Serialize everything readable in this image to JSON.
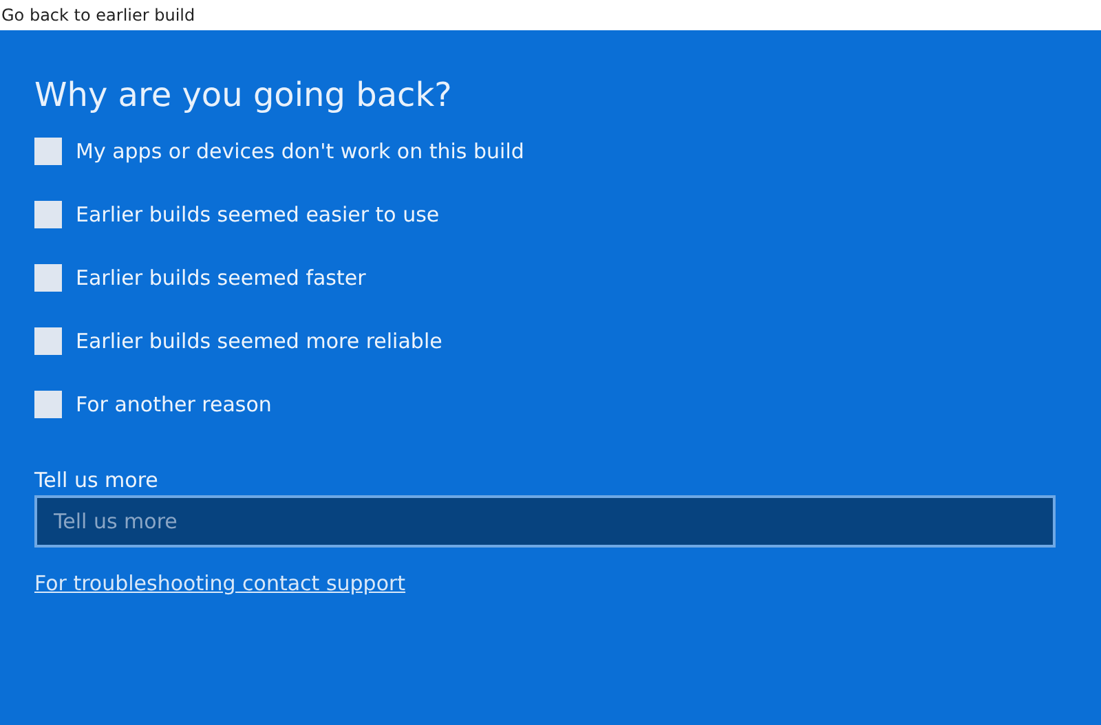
{
  "window": {
    "title": "Go back to earlier build"
  },
  "heading": "Why are you going back?",
  "options": [
    {
      "label": "My apps or devices don't work on this build",
      "checked": false
    },
    {
      "label": "Earlier builds seemed easier to use",
      "checked": false
    },
    {
      "label": "Earlier builds seemed faster",
      "checked": false
    },
    {
      "label": "Earlier builds seemed more reliable",
      "checked": false
    },
    {
      "label": "For another reason",
      "checked": false
    }
  ],
  "details": {
    "label": "Tell us more",
    "placeholder": "Tell us more"
  },
  "support_link": "For troubleshooting contact support"
}
